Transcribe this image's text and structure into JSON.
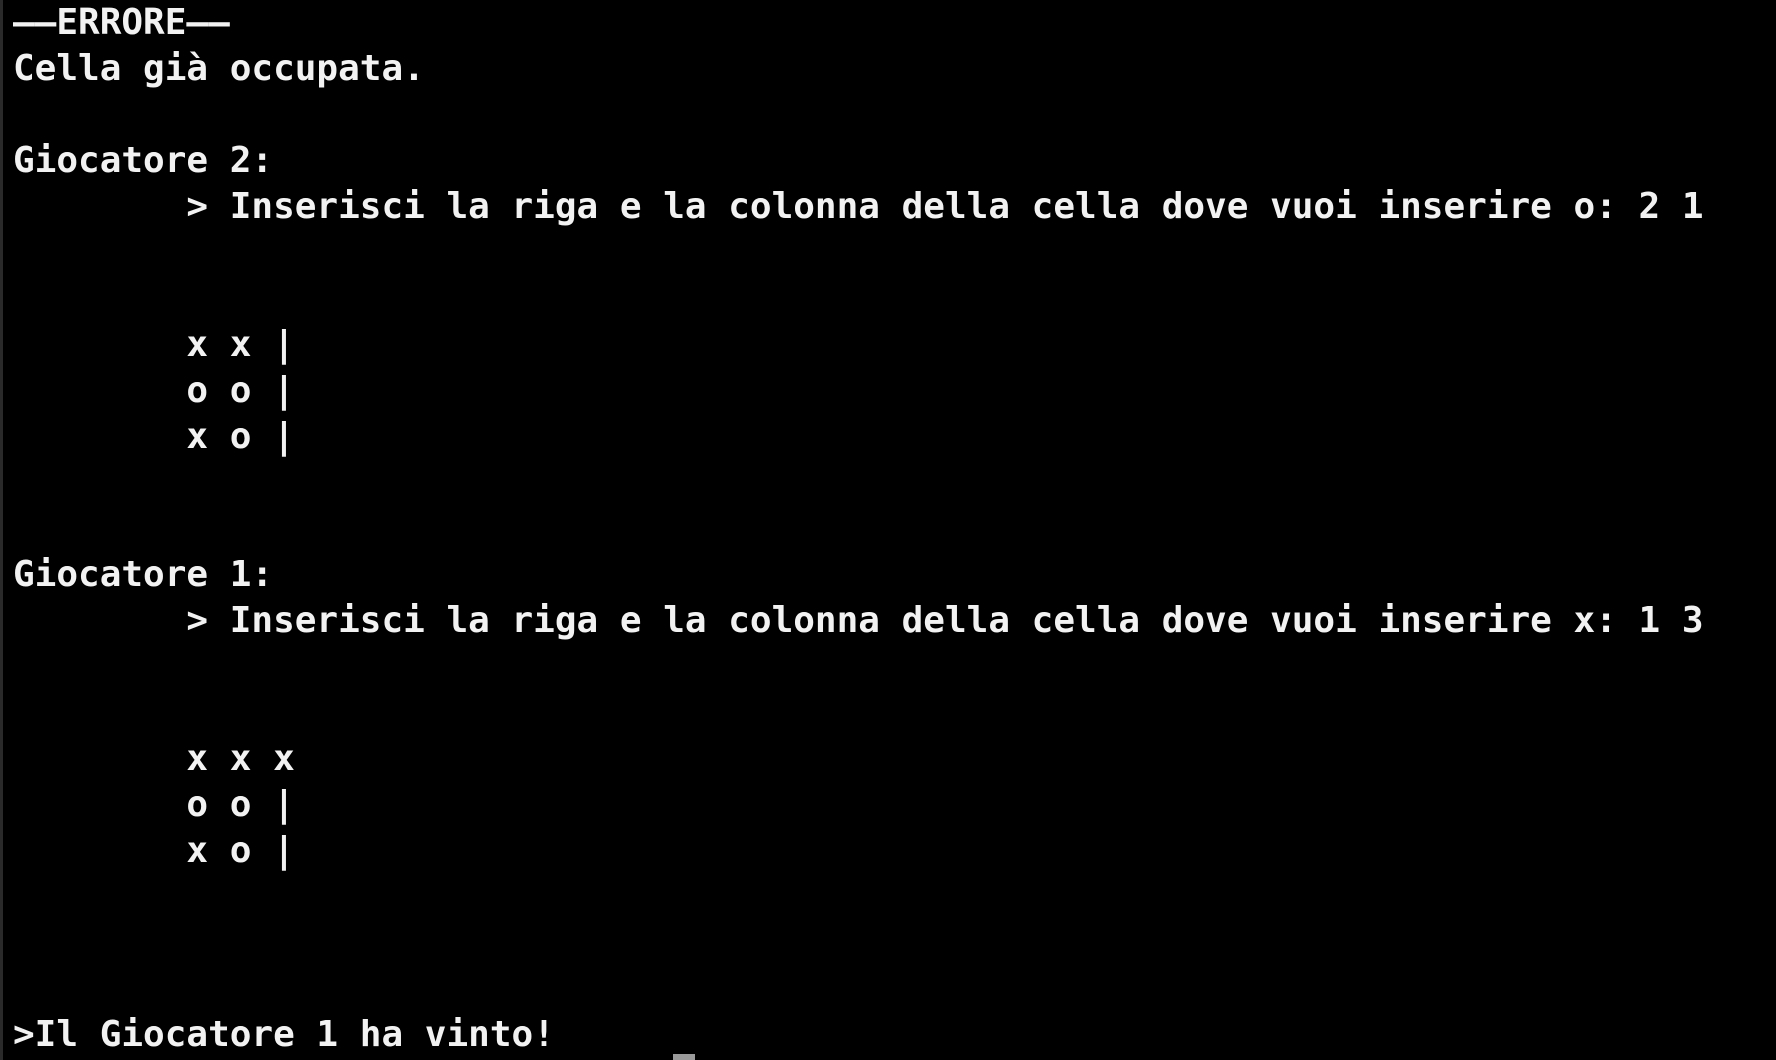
{
  "terminal": {
    "colors": {
      "background": "#000000",
      "text": "#f2f2f2",
      "cursor": "#9a9a9a"
    },
    "lines": [
      "——ERRORE——",
      "Cella già occupata.",
      "",
      "Giocatore 2:",
      "        > Inserisci la riga e la colonna della cella dove vuoi inserire o: 2 1",
      "",
      "",
      "        x x |",
      "        o o |",
      "        x o |",
      "",
      "",
      "Giocatore 1:",
      "        > Inserisci la riga e la colonna della cella dove vuoi inserire x: 1 3",
      "",
      "",
      "        x x x",
      "        o o |",
      "        x o |",
      "",
      "",
      "",
      ">Il Giocatore 1 ha vinto!"
    ]
  }
}
